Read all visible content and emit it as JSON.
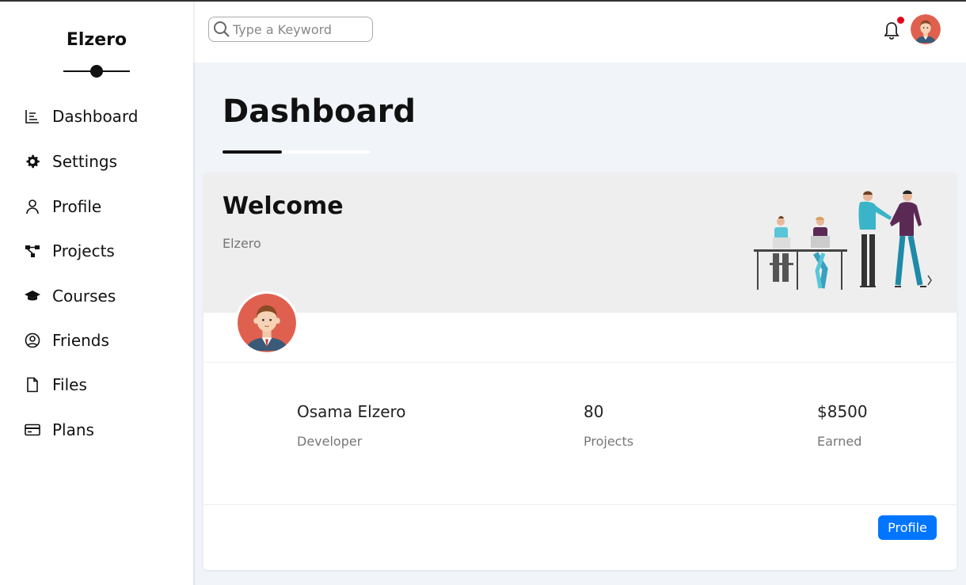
{
  "brand": {
    "name": "Elzero"
  },
  "sidebar": {
    "items": [
      {
        "label": "Dashboard",
        "icon": "chart-icon"
      },
      {
        "label": "Settings",
        "icon": "gear-icon"
      },
      {
        "label": "Profile",
        "icon": "user-icon"
      },
      {
        "label": "Projects",
        "icon": "diagram-icon"
      },
      {
        "label": "Courses",
        "icon": "graduation-cap-icon"
      },
      {
        "label": "Friends",
        "icon": "user-circle-icon"
      },
      {
        "label": "Files",
        "icon": "file-icon"
      },
      {
        "label": "Plans",
        "icon": "credit-card-icon"
      }
    ]
  },
  "header": {
    "search_placeholder": "Type a Keyword",
    "has_notification": true
  },
  "main": {
    "title": "Dashboard",
    "welcome": {
      "title": "Welcome",
      "subtitle": "Elzero",
      "stats": [
        {
          "value": "Osama Elzero",
          "label": "Developer"
        },
        {
          "value": "80",
          "label": "Projects"
        },
        {
          "value": "$8500",
          "label": "Earned"
        }
      ],
      "button_label": "Profile"
    }
  },
  "colors": {
    "accent": "#0075ff",
    "notification": "#e0001a",
    "background": "#f1f5f9",
    "card_header": "#eeeeee"
  }
}
